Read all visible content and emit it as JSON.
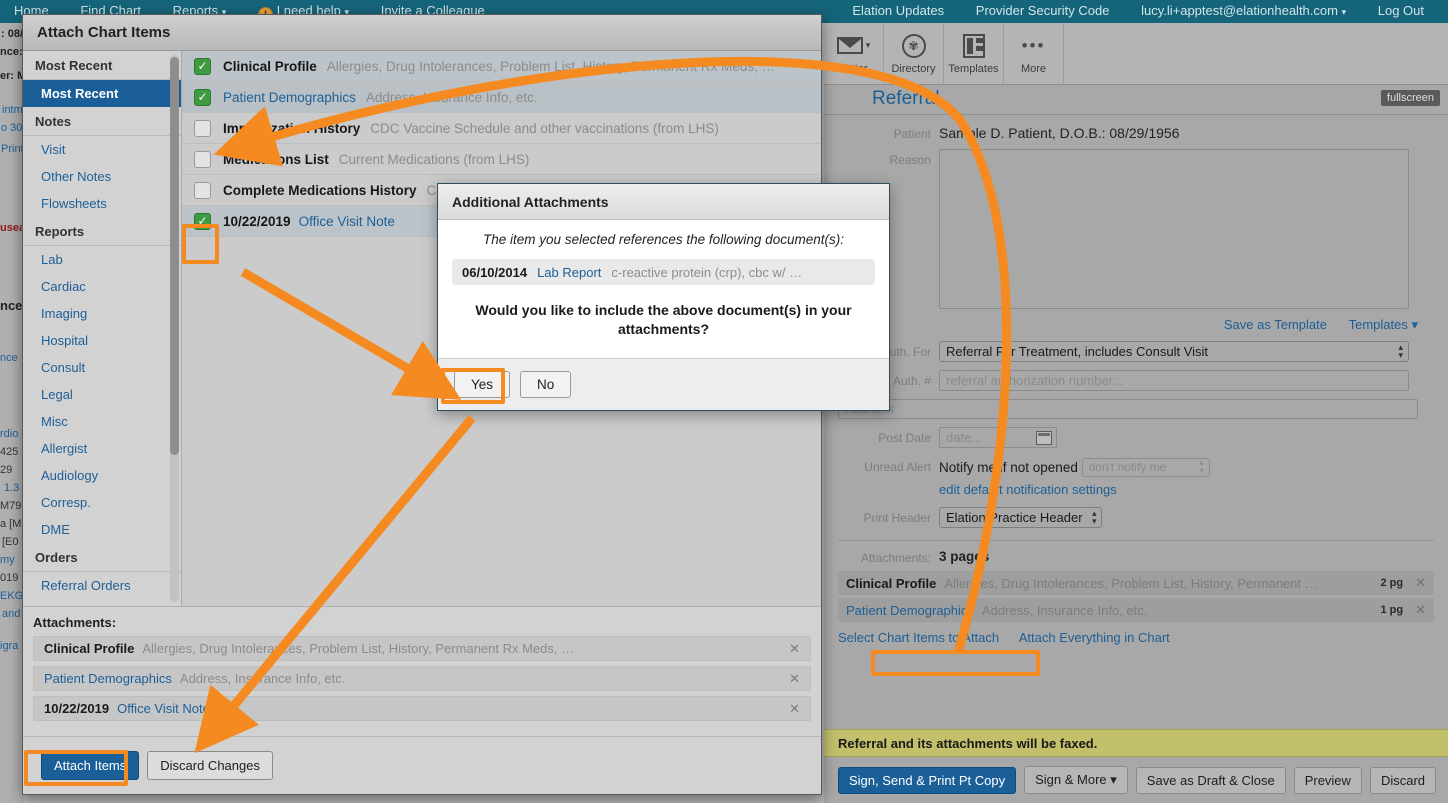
{
  "topnav": {
    "left_links": [
      "Home",
      "Find Chart",
      "Reports",
      "I need help",
      "Invite a Colleague"
    ],
    "reports_caret": "▾",
    "help_caret": "▾",
    "help_badge": "!",
    "right_links": [
      "Elation Updates",
      "Provider Security Code"
    ],
    "account": "lucy.li+apptest@elationhealth.com",
    "account_caret": "▾",
    "logout": "Log Out"
  },
  "toolbar": {
    "items": [
      {
        "label": "Letter",
        "icon": "envelope-icon"
      },
      {
        "label": "Directory",
        "icon": "directory-icon"
      },
      {
        "label": "Templates",
        "icon": "templates-icon"
      },
      {
        "label": "More",
        "icon": "more-dots-icon"
      }
    ]
  },
  "left_strip": {
    "lines": [
      ": 08/",
      "nce:",
      "er: M",
      "intm",
      "o 30",
      "Print",
      "usea",
      "nce",
      "nce",
      "rdio",
      "425",
      "29",
      "1.3",
      "M79",
      "a [M",
      "[E0",
      "my",
      "019",
      "EKG",
      "and",
      "igra"
    ]
  },
  "referral": {
    "title": "Referral",
    "fullscreen": "fullscreen",
    "patient_label": "Patient",
    "patient_value": "Sample D. Patient, D.O.B.: 08/29/1956",
    "reason_label": "Reason",
    "reason_value": "",
    "save_as_template": "Save as Template",
    "templates": "Templates",
    "templates_caret": "▾",
    "auth_for_label": "Auth. For",
    "auth_for_value": "Referral For Treatment, includes Consult Visit",
    "auth_num_label": "Auth. #",
    "auth_num_placeholder": "referral authorization number...",
    "add_dxs_placeholder": "Add Dxs",
    "post_date_label": "Post Date",
    "post_date_placeholder": "date...",
    "unread_alert_label": "Unread Alert",
    "unread_alert_text": "Notify me if not opened",
    "notify_select_value": "don't notify me",
    "edit_defaults_link": "edit default notification settings",
    "print_header_label": "Print Header",
    "print_header_value": "Elation Practice Header",
    "attachments_label": "Attachments:",
    "attachments_pages": "3 pages",
    "attachments": [
      {
        "name": "Clinical Profile",
        "desc": "Allergies, Drug Intolerances, Problem List, History, Permanent …",
        "pages": "2 pg",
        "remove": "✕",
        "is_link": false
      },
      {
        "name": "Patient Demographics",
        "desc": "Address, Insurance Info, etc.",
        "pages": "1 pg",
        "remove": "✕",
        "is_link": true
      }
    ],
    "select_chart_items_link": "Select Chart Items to Attach",
    "attach_everything_link": "Attach Everything in Chart",
    "fax_notice": "Referral and its attachments will be faxed.",
    "buttons": [
      {
        "label": "Sign, Send & Print Pt Copy",
        "primary": true
      },
      {
        "label": "Sign & More",
        "primary": false,
        "caret": "▾"
      },
      {
        "label": "Save as Draft & Close",
        "primary": false
      },
      {
        "label": "Preview",
        "primary": false
      },
      {
        "label": "Discard",
        "primary": false
      }
    ]
  },
  "modal": {
    "title": "Attach Chart Items",
    "sidebar": [
      {
        "type": "section",
        "label": "Most Recent"
      },
      {
        "type": "item",
        "label": "Most Recent",
        "active": true
      },
      {
        "type": "section",
        "label": "Notes"
      },
      {
        "type": "item",
        "label": "Visit"
      },
      {
        "type": "item",
        "label": "Other Notes"
      },
      {
        "type": "item",
        "label": "Flowsheets"
      },
      {
        "type": "section",
        "label": "Reports"
      },
      {
        "type": "item",
        "label": "Lab"
      },
      {
        "type": "item",
        "label": "Cardiac"
      },
      {
        "type": "item",
        "label": "Imaging"
      },
      {
        "type": "item",
        "label": "Hospital"
      },
      {
        "type": "item",
        "label": "Consult"
      },
      {
        "type": "item",
        "label": "Legal"
      },
      {
        "type": "item",
        "label": "Misc"
      },
      {
        "type": "item",
        "label": "Allergist"
      },
      {
        "type": "item",
        "label": "Audiology"
      },
      {
        "type": "item",
        "label": "Corresp."
      },
      {
        "type": "item",
        "label": "DME"
      },
      {
        "type": "section",
        "label": "Orders"
      },
      {
        "type": "item",
        "label": "Referral Orders"
      }
    ],
    "list": [
      {
        "checked": true,
        "title": "Clinical Profile",
        "is_link": false,
        "date": "",
        "desc": "Allergies, Drug Intolerances, Problem List, History, Permanent Rx Meds, …",
        "tint": 1
      },
      {
        "checked": true,
        "title": "Patient Demographics",
        "is_link": true,
        "date": "",
        "desc": "Address, Insurance Info, etc.",
        "tint": 2
      },
      {
        "checked": false,
        "title": "Immunization History",
        "is_link": false,
        "date": "",
        "desc": "CDC Vaccine Schedule and other vaccinations (from LHS)",
        "tint": 0
      },
      {
        "checked": false,
        "title": "Medications List",
        "is_link": false,
        "date": "",
        "desc": "Current Medications (from LHS)",
        "tint": 0
      },
      {
        "checked": false,
        "title": "Complete Medications History",
        "is_link": false,
        "date": "",
        "desc": "Current …",
        "tint": 0
      },
      {
        "checked": true,
        "title": "Office Visit Note",
        "is_link": true,
        "date": "10/22/2019",
        "desc": "",
        "tint": 1
      }
    ],
    "attachments_label": "Attachments:",
    "attachments": [
      {
        "name": "Clinical Profile",
        "is_link": false,
        "date": "",
        "desc": "Allergies, Drug Intolerances, Problem List, History, Permanent Rx Meds, …",
        "remove": "✕"
      },
      {
        "name": "Patient Demographics",
        "is_link": true,
        "date": "",
        "desc": "Address, Insurance Info, etc.",
        "remove": "✕"
      },
      {
        "name": "Office Visit Note",
        "is_link": true,
        "date": "10/22/2019",
        "desc": "",
        "remove": "✕"
      }
    ],
    "attach_items_button": "Attach Items",
    "discard_changes_button": "Discard Changes"
  },
  "dialog": {
    "title": "Additional Attachments",
    "intro": "The item you selected references the following document(s):",
    "doc_date": "06/10/2014",
    "doc_name": "Lab Report",
    "doc_desc": "c-reactive protein (crp), cbc w/ …",
    "question": "Would you like to include the above document(s) in your attachments?",
    "yes_button": "Yes",
    "no_button": "No"
  },
  "annotations": {
    "accent_color": "#f58a21",
    "highlight_boxes": [
      "office-visit-note-checkbox",
      "yes-button",
      "attach-items-button",
      "select-chart-items-to-attach-link"
    ]
  }
}
